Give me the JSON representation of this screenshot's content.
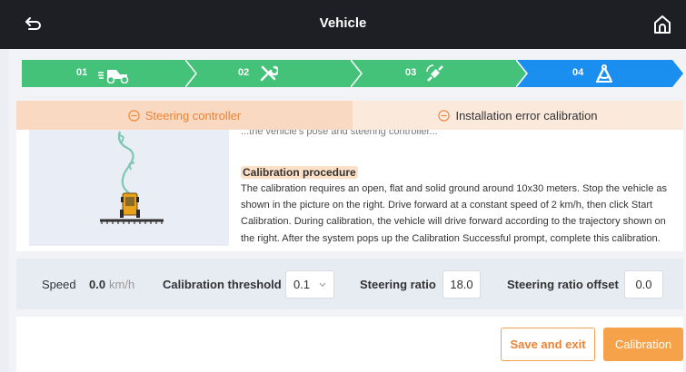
{
  "header": {
    "title": "Vehicle",
    "back_icon": "back-arrow-icon",
    "home_icon": "home-icon"
  },
  "steps": [
    {
      "number": "01",
      "icon": "tractor-icon",
      "state": "done"
    },
    {
      "number": "02",
      "icon": "tools-icon",
      "state": "done"
    },
    {
      "number": "03",
      "icon": "satellite-icon",
      "state": "done"
    },
    {
      "number": "04",
      "icon": "calibration-icon",
      "state": "active"
    }
  ],
  "tabs": [
    {
      "label": "Steering controller",
      "icon": "minus-circle-icon",
      "active": true
    },
    {
      "label": "Installation error calibration",
      "icon": "minus-circle-icon",
      "active": false
    }
  ],
  "procedure": {
    "clipped_line": "...the vehicle's pose and steering controller...",
    "title": "Calibration procedure",
    "text": "The calibration requires an open, flat and solid ground around 10x30 meters. Stop the vehicle as shown in the picture on the right. Drive forward at a constant speed of 2 km/h, then click Start Calibration. During calibration, the vehicle will drive forward according to the trajectory shown on the right. After the system pops up the Calibration Successful prompt, complete this calibration."
  },
  "params": {
    "speed_label": "Speed",
    "speed_value": "0.0",
    "speed_unit": "km/h",
    "threshold_label": "Calibration threshold",
    "threshold_value": "0.1",
    "steering_ratio_label": "Steering ratio",
    "steering_ratio_value": "18.0",
    "offset_label": "Steering ratio offset",
    "offset_value": "0.0"
  },
  "footer": {
    "save_label": "Save and exit",
    "calibration_label": "Calibration"
  },
  "colors": {
    "header_bg": "#1d1f24",
    "step_done": "#44c27a",
    "step_active": "#1a8ff0",
    "accent_orange": "#f6a24a",
    "tab_active_bg": "#fad9c2",
    "tab_inactive_bg": "#fbe9dc"
  }
}
